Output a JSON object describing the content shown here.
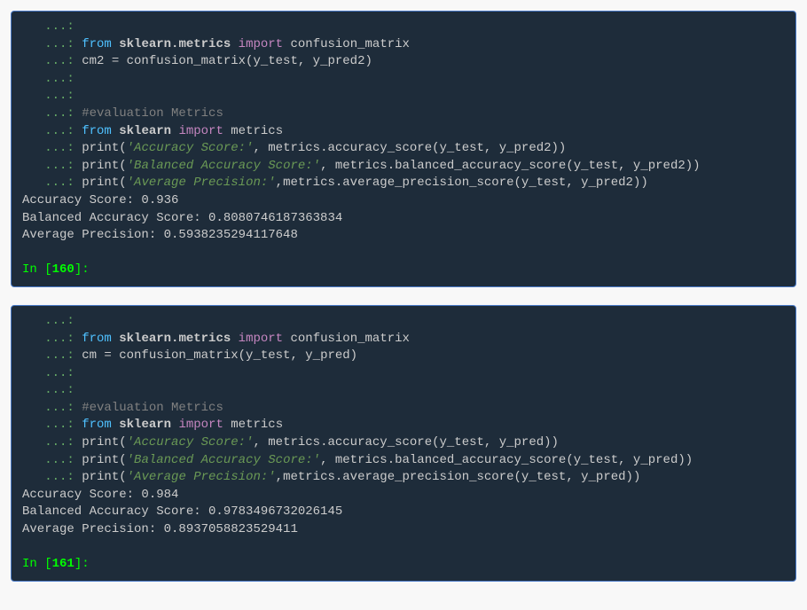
{
  "cells": [
    {
      "code": [
        {
          "type": "blank"
        },
        {
          "type": "import_from",
          "mod": "sklearn.metrics",
          "name": "confusion_matrix"
        },
        {
          "type": "assign",
          "lhs": "cm2",
          "fn": "confusion_matrix",
          "args": "y_test, y_pred2"
        },
        {
          "type": "blank"
        },
        {
          "type": "blank"
        },
        {
          "type": "comment",
          "text": "#evaluation Metrics"
        },
        {
          "type": "import_from",
          "mod": "sklearn",
          "name": "metrics"
        },
        {
          "type": "print",
          "label": "'Accuracy Score:'",
          "sep": ", ",
          "expr": "metrics.accuracy_score(y_test, y_pred2)"
        },
        {
          "type": "print",
          "label": "'Balanced Accuracy Score:'",
          "sep": ", ",
          "expr": "metrics.balanced_accuracy_score(y_test, y_pred2)"
        },
        {
          "type": "print",
          "label": "'Average Precision:'",
          "sep": ",",
          "expr": "metrics.average_precision_score(y_test, y_pred2)"
        }
      ],
      "output": [
        "Accuracy Score: 0.936",
        "Balanced Accuracy Score: 0.8080746187363834",
        "Average Precision: 0.5938235294117648"
      ],
      "next_prompt": "160"
    },
    {
      "code": [
        {
          "type": "blank"
        },
        {
          "type": "import_from",
          "mod": "sklearn.metrics",
          "name": "confusion_matrix"
        },
        {
          "type": "assign",
          "lhs": "cm",
          "fn": "confusion_matrix",
          "args": "y_test, y_pred"
        },
        {
          "type": "blank"
        },
        {
          "type": "blank"
        },
        {
          "type": "comment",
          "text": "#evaluation Metrics"
        },
        {
          "type": "import_from",
          "mod": "sklearn",
          "name": "metrics"
        },
        {
          "type": "print",
          "label": "'Accuracy Score:'",
          "sep": ", ",
          "expr": "metrics.accuracy_score(y_test, y_pred)"
        },
        {
          "type": "print",
          "label": "'Balanced Accuracy Score:'",
          "sep": ", ",
          "expr": "metrics.balanced_accuracy_score(y_test, y_pred)"
        },
        {
          "type": "print",
          "label": "'Average Precision:'",
          "sep": ",",
          "expr": "metrics.average_precision_score(y_test, y_pred)"
        }
      ],
      "output": [
        "Accuracy Score: 0.984",
        "Balanced Accuracy Score: 0.9783496732026145",
        "Average Precision: 0.8937058823529411"
      ],
      "next_prompt": "161"
    }
  ],
  "tokens": {
    "cont": "   ...: ",
    "from": "from",
    "import": "import",
    "print": "print",
    "in_prefix": "In [",
    "in_suffix": "]:"
  }
}
